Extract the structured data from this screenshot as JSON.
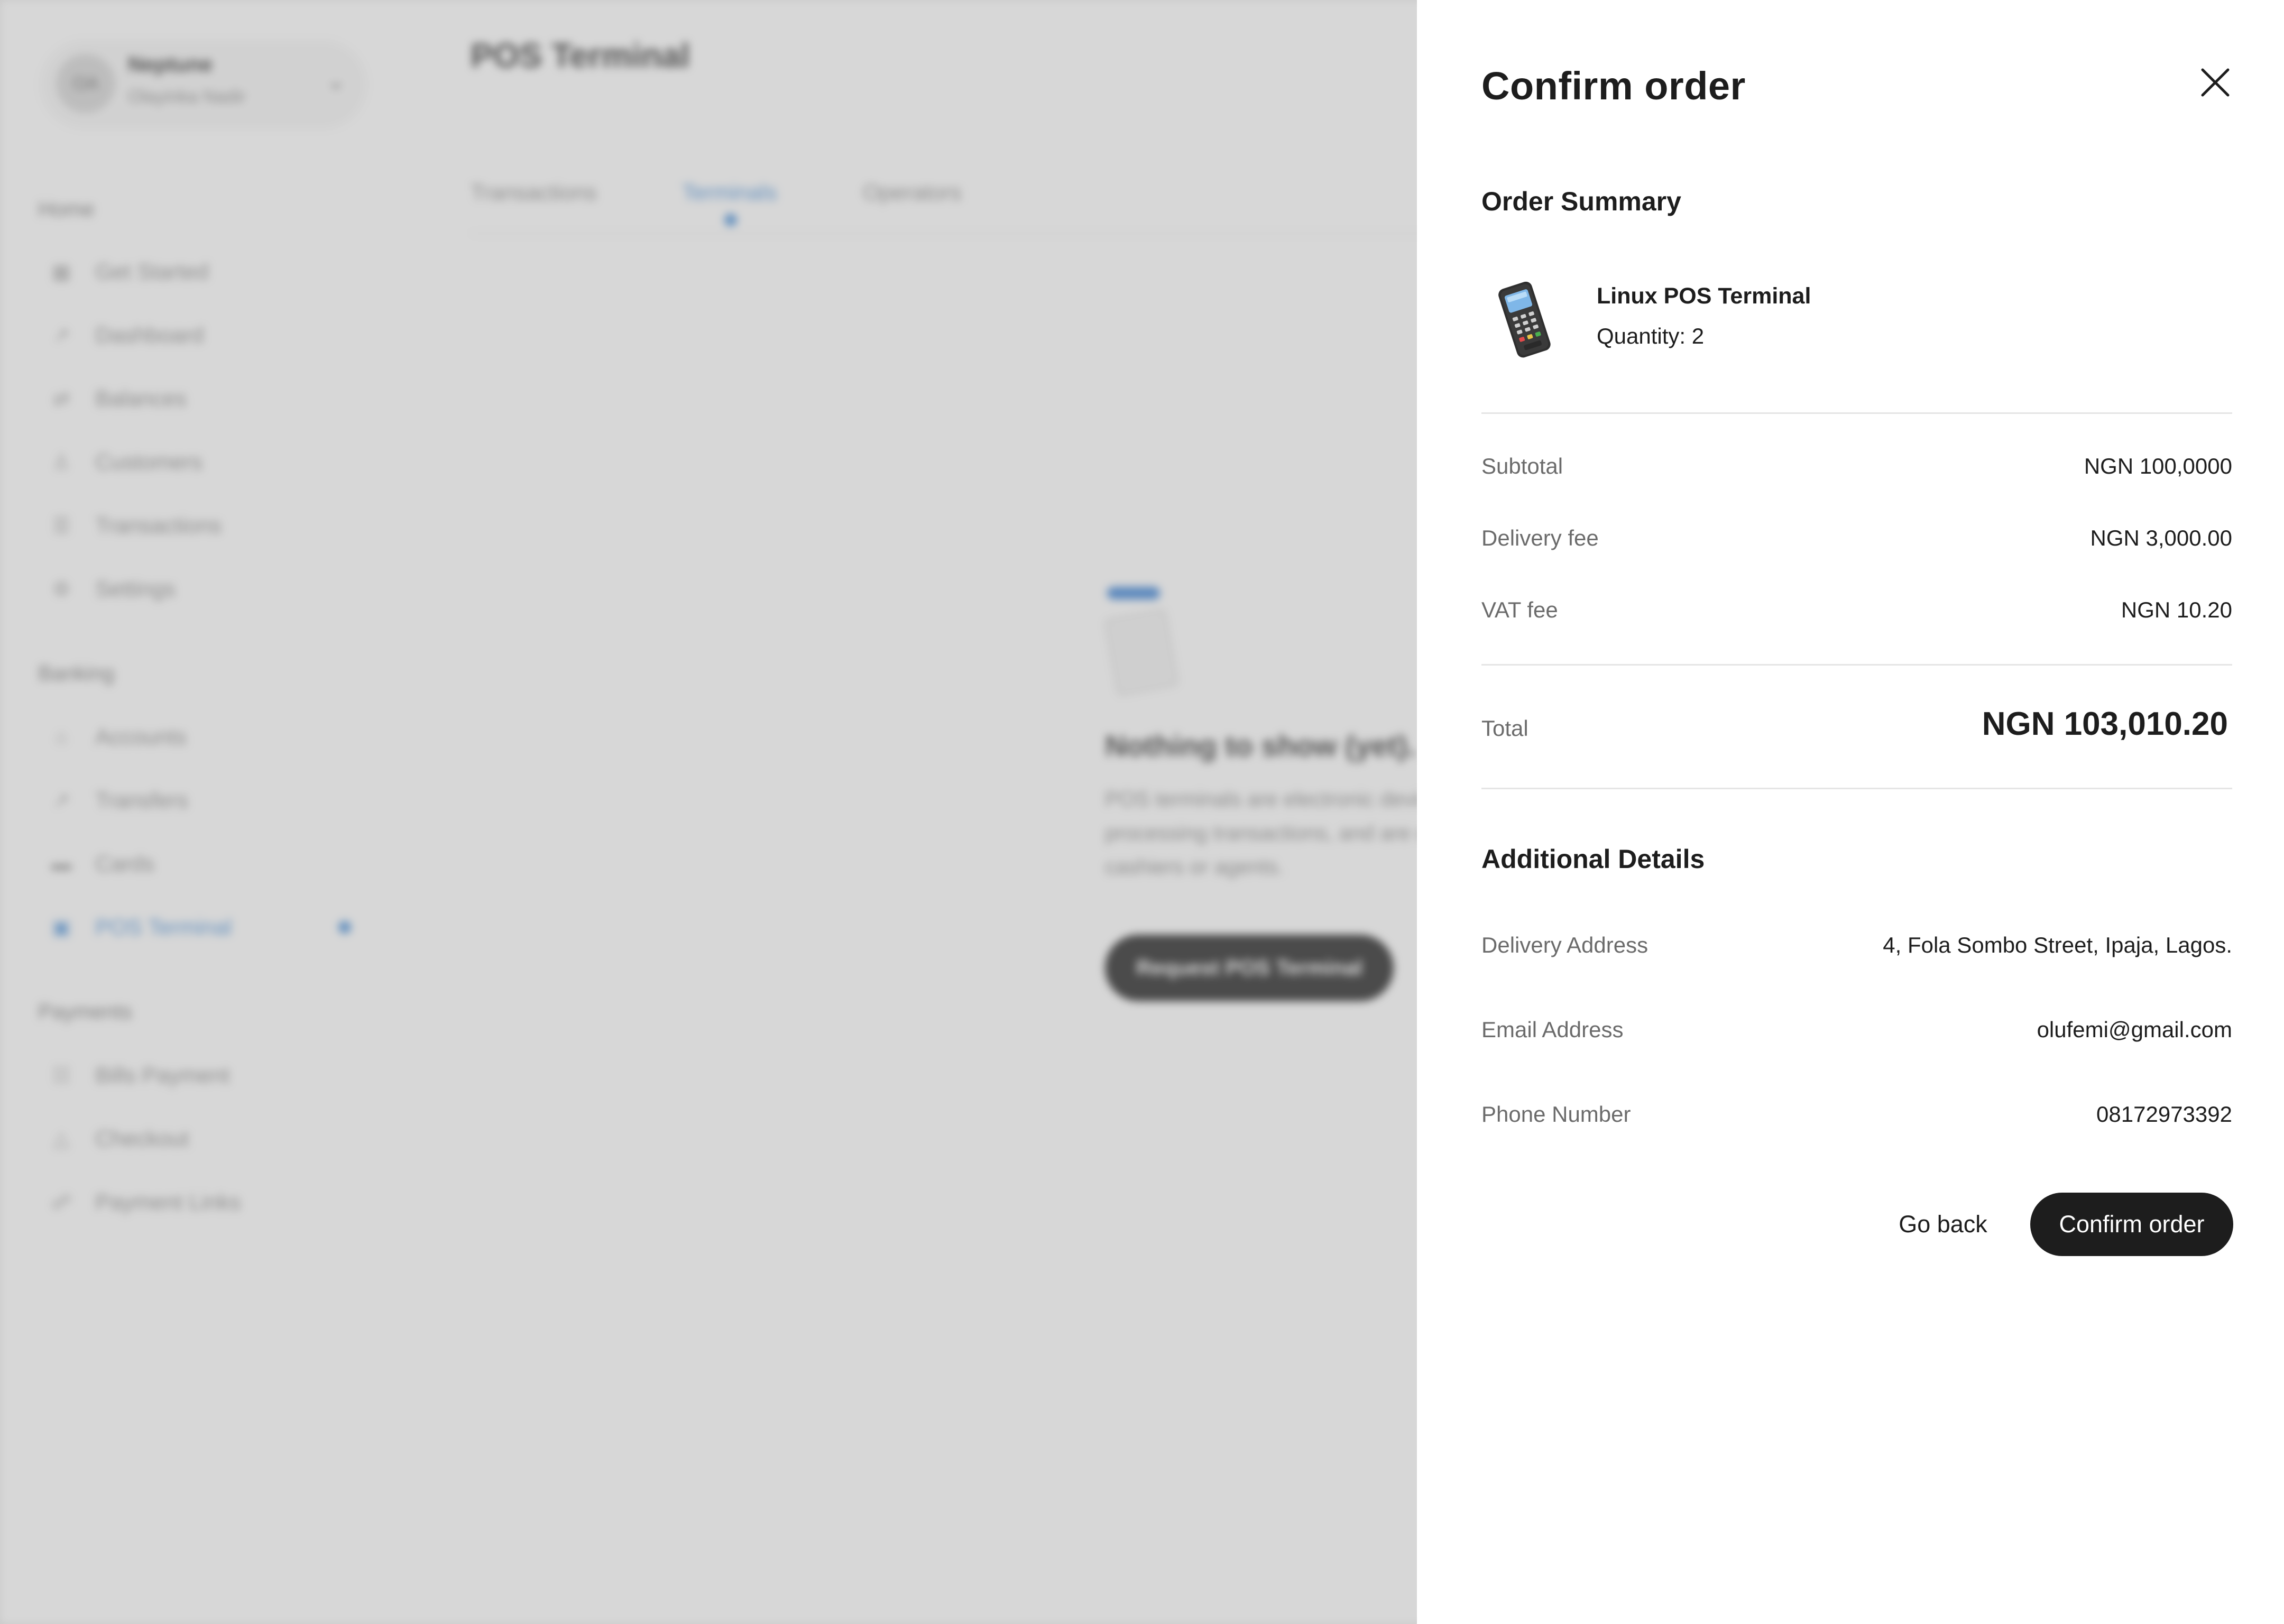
{
  "background": {
    "account": {
      "initials": "OA",
      "name": "Neptune",
      "subtitle": "Olayinka Nadir"
    },
    "nav": {
      "home_section": "Home",
      "banking_section": "Banking",
      "payments_section": "Payments",
      "items": [
        {
          "label": "Get Started",
          "icon": "grid-icon"
        },
        {
          "label": "Dashboard",
          "icon": "chart-icon"
        },
        {
          "label": "Balances",
          "icon": "balance-icon"
        },
        {
          "label": "Customers",
          "icon": "users-icon"
        },
        {
          "label": "Transactions",
          "icon": "list-icon"
        },
        {
          "label": "Settings",
          "icon": "gear-icon"
        },
        {
          "label": "Accounts",
          "icon": "bank-icon"
        },
        {
          "label": "Transfers",
          "icon": "transfer-icon"
        },
        {
          "label": "Cards",
          "icon": "card-icon"
        },
        {
          "label": "POS Terminal",
          "icon": "pos-icon",
          "active": true
        },
        {
          "label": "Bills Payment",
          "icon": "bill-icon"
        },
        {
          "label": "Checkout",
          "icon": "checkout-icon"
        },
        {
          "label": "Payment Links",
          "icon": "link-icon"
        }
      ]
    },
    "page_title": "POS Terminal",
    "tabs": [
      "Transactions",
      "Terminals",
      "Operators"
    ],
    "active_tab": "Terminals",
    "empty_state": {
      "title": "Nothing to show (yet).",
      "description": "POS terminals are electronic devices for processing transactions, and are operated by cashiers or agents.",
      "button": "Request POS Terminal"
    }
  },
  "drawer": {
    "title": "Confirm order",
    "order_summary_title": "Order Summary",
    "product": {
      "name": "Linux POS Terminal",
      "quantity_label": "Quantity: 2"
    },
    "fees": [
      {
        "label": "Subtotal",
        "value": "NGN 100,0000"
      },
      {
        "label": "Delivery fee",
        "value": "NGN 3,000.00"
      },
      {
        "label": "VAT fee",
        "value": "NGN 10.20"
      }
    ],
    "total": {
      "label": "Total",
      "value": "NGN 103,010.20"
    },
    "additional_details_title": "Additional Details",
    "details": [
      {
        "label": "Delivery Address",
        "value": "4, Fola Sombo Street, Ipaja, Lagos."
      },
      {
        "label": "Email Address",
        "value": "olufemi@gmail.com"
      },
      {
        "label": "Phone Number",
        "value": "08172973392"
      }
    ],
    "go_back_label": "Go back",
    "confirm_label": "Confirm order"
  },
  "colors": {
    "accent": "#4a90d9",
    "primary_button": "#1d1d1d",
    "scrim": "#969696"
  }
}
